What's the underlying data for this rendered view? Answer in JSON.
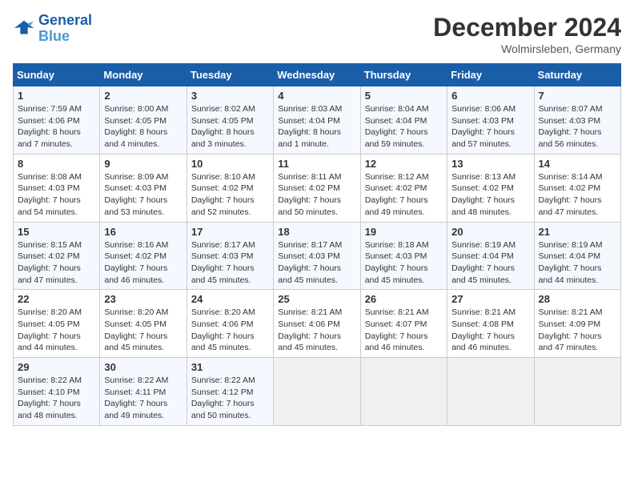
{
  "header": {
    "logo_line1": "General",
    "logo_line2": "Blue",
    "month_title": "December 2024",
    "location": "Wolmirsleben, Germany"
  },
  "days_of_week": [
    "Sunday",
    "Monday",
    "Tuesday",
    "Wednesday",
    "Thursday",
    "Friday",
    "Saturday"
  ],
  "weeks": [
    [
      {
        "day": "1",
        "info": "Sunrise: 7:59 AM\nSunset: 4:06 PM\nDaylight: 8 hours\nand 7 minutes."
      },
      {
        "day": "2",
        "info": "Sunrise: 8:00 AM\nSunset: 4:05 PM\nDaylight: 8 hours\nand 4 minutes."
      },
      {
        "day": "3",
        "info": "Sunrise: 8:02 AM\nSunset: 4:05 PM\nDaylight: 8 hours\nand 3 minutes."
      },
      {
        "day": "4",
        "info": "Sunrise: 8:03 AM\nSunset: 4:04 PM\nDaylight: 8 hours\nand 1 minute."
      },
      {
        "day": "5",
        "info": "Sunrise: 8:04 AM\nSunset: 4:04 PM\nDaylight: 7 hours\nand 59 minutes."
      },
      {
        "day": "6",
        "info": "Sunrise: 8:06 AM\nSunset: 4:03 PM\nDaylight: 7 hours\nand 57 minutes."
      },
      {
        "day": "7",
        "info": "Sunrise: 8:07 AM\nSunset: 4:03 PM\nDaylight: 7 hours\nand 56 minutes."
      }
    ],
    [
      {
        "day": "8",
        "info": "Sunrise: 8:08 AM\nSunset: 4:03 PM\nDaylight: 7 hours\nand 54 minutes."
      },
      {
        "day": "9",
        "info": "Sunrise: 8:09 AM\nSunset: 4:03 PM\nDaylight: 7 hours\nand 53 minutes."
      },
      {
        "day": "10",
        "info": "Sunrise: 8:10 AM\nSunset: 4:02 PM\nDaylight: 7 hours\nand 52 minutes."
      },
      {
        "day": "11",
        "info": "Sunrise: 8:11 AM\nSunset: 4:02 PM\nDaylight: 7 hours\nand 50 minutes."
      },
      {
        "day": "12",
        "info": "Sunrise: 8:12 AM\nSunset: 4:02 PM\nDaylight: 7 hours\nand 49 minutes."
      },
      {
        "day": "13",
        "info": "Sunrise: 8:13 AM\nSunset: 4:02 PM\nDaylight: 7 hours\nand 48 minutes."
      },
      {
        "day": "14",
        "info": "Sunrise: 8:14 AM\nSunset: 4:02 PM\nDaylight: 7 hours\nand 47 minutes."
      }
    ],
    [
      {
        "day": "15",
        "info": "Sunrise: 8:15 AM\nSunset: 4:02 PM\nDaylight: 7 hours\nand 47 minutes."
      },
      {
        "day": "16",
        "info": "Sunrise: 8:16 AM\nSunset: 4:02 PM\nDaylight: 7 hours\nand 46 minutes."
      },
      {
        "day": "17",
        "info": "Sunrise: 8:17 AM\nSunset: 4:03 PM\nDaylight: 7 hours\nand 45 minutes."
      },
      {
        "day": "18",
        "info": "Sunrise: 8:17 AM\nSunset: 4:03 PM\nDaylight: 7 hours\nand 45 minutes."
      },
      {
        "day": "19",
        "info": "Sunrise: 8:18 AM\nSunset: 4:03 PM\nDaylight: 7 hours\nand 45 minutes."
      },
      {
        "day": "20",
        "info": "Sunrise: 8:19 AM\nSunset: 4:04 PM\nDaylight: 7 hours\nand 45 minutes."
      },
      {
        "day": "21",
        "info": "Sunrise: 8:19 AM\nSunset: 4:04 PM\nDaylight: 7 hours\nand 44 minutes."
      }
    ],
    [
      {
        "day": "22",
        "info": "Sunrise: 8:20 AM\nSunset: 4:05 PM\nDaylight: 7 hours\nand 44 minutes."
      },
      {
        "day": "23",
        "info": "Sunrise: 8:20 AM\nSunset: 4:05 PM\nDaylight: 7 hours\nand 45 minutes."
      },
      {
        "day": "24",
        "info": "Sunrise: 8:20 AM\nSunset: 4:06 PM\nDaylight: 7 hours\nand 45 minutes."
      },
      {
        "day": "25",
        "info": "Sunrise: 8:21 AM\nSunset: 4:06 PM\nDaylight: 7 hours\nand 45 minutes."
      },
      {
        "day": "26",
        "info": "Sunrise: 8:21 AM\nSunset: 4:07 PM\nDaylight: 7 hours\nand 46 minutes."
      },
      {
        "day": "27",
        "info": "Sunrise: 8:21 AM\nSunset: 4:08 PM\nDaylight: 7 hours\nand 46 minutes."
      },
      {
        "day": "28",
        "info": "Sunrise: 8:21 AM\nSunset: 4:09 PM\nDaylight: 7 hours\nand 47 minutes."
      }
    ],
    [
      {
        "day": "29",
        "info": "Sunrise: 8:22 AM\nSunset: 4:10 PM\nDaylight: 7 hours\nand 48 minutes."
      },
      {
        "day": "30",
        "info": "Sunrise: 8:22 AM\nSunset: 4:11 PM\nDaylight: 7 hours\nand 49 minutes."
      },
      {
        "day": "31",
        "info": "Sunrise: 8:22 AM\nSunset: 4:12 PM\nDaylight: 7 hours\nand 50 minutes."
      },
      {
        "day": "",
        "info": ""
      },
      {
        "day": "",
        "info": ""
      },
      {
        "day": "",
        "info": ""
      },
      {
        "day": "",
        "info": ""
      }
    ]
  ]
}
